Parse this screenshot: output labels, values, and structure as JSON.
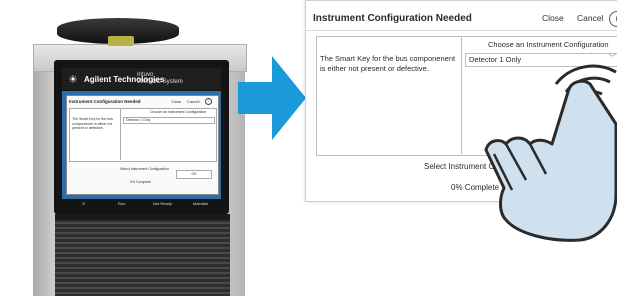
{
  "instrument": {
    "brand": "Agilent Technologies",
    "model_line1": "Intuvo",
    "model_line2": "9000 GC System",
    "brand_icon": "agilent-spark-icon",
    "status_bar": {
      "item1": "⊙",
      "item2": "Run",
      "item3": "Not Ready",
      "item4": "Maintain"
    },
    "mini_dialog": {
      "title": "Instrument Configuration Needed",
      "close": "Close",
      "cancel": "Cancel",
      "help": "?",
      "choose": "Choose an Instrument Configuration",
      "message": "The Smart Key for the bus componenent is either not present or defective.",
      "selected": "Detector 1 Only",
      "select_label": "Select Instrument Configuration",
      "ok": "OK",
      "progress": "0% Complete"
    }
  },
  "dialog": {
    "title": "Instrument Configuration Needed",
    "close_label": "Close",
    "cancel_label": "Cancel",
    "help_label": "(",
    "message": "The Smart Key for the bus componenent is either not present or defective.",
    "choose_label": "Choose an Instrument Configuration",
    "selected_config": "Detector 1 Only",
    "select_label": "Select Instrument Configu",
    "progress": "0% Complete"
  },
  "icons": {
    "arrow": "arrow-right-icon",
    "hand": "touch-hand-icon"
  },
  "colors": {
    "arrow": "#1a9ad9",
    "screen_bg": "#2a6fa8",
    "hand_fill": "#cfe0ee",
    "hand_stroke": "#2b2b2b"
  }
}
